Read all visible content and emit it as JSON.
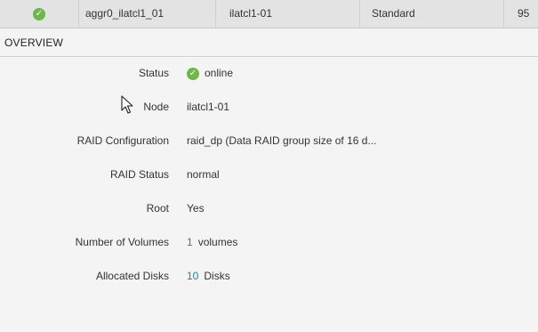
{
  "aggregate_row": {
    "status_icon": "check-circle-icon",
    "name": "aggr0_ilatcl1_01",
    "node": "ilatcl1-01",
    "type": "Standard",
    "number": "95"
  },
  "overview": {
    "title": "OVERVIEW",
    "status": {
      "label": "Status",
      "value": "online",
      "icon": "check-circle-icon"
    },
    "node": {
      "label": "Node",
      "value": "ilatcl1-01"
    },
    "raid_config": {
      "label": "RAID Configuration",
      "value": "raid_dp (Data RAID group size of 16 d..."
    },
    "raid_status": {
      "label": "RAID Status",
      "value": "normal"
    },
    "root": {
      "label": "Root",
      "value": "Yes"
    },
    "volumes": {
      "label": "Number of Volumes",
      "count": "1",
      "unit": "volumes"
    },
    "disks": {
      "label": "Allocated Disks",
      "count": "10",
      "unit": "Disks"
    }
  },
  "colors": {
    "online_green": "#6db74b",
    "link_blue": "#1a7fb8",
    "row_selected": "#e3e3e3",
    "background": "#f4f4f4"
  }
}
